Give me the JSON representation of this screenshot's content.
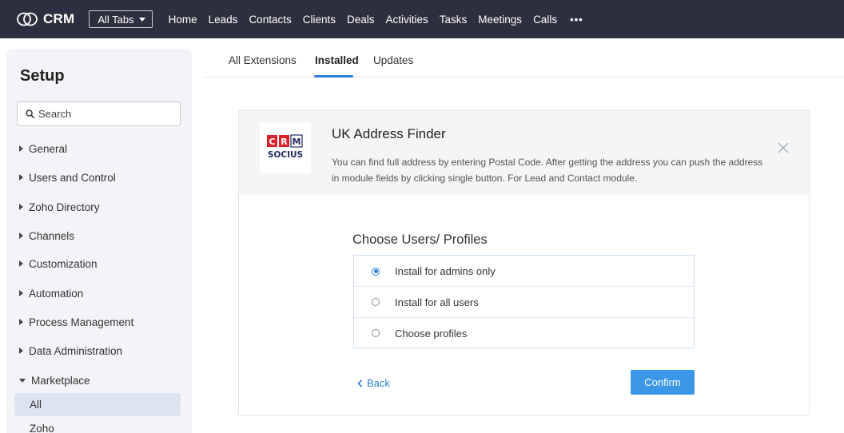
{
  "app": {
    "logo_text": "CRM",
    "all_tabs_label": "All Tabs"
  },
  "nav": {
    "items": [
      "Home",
      "Leads",
      "Contacts",
      "Clients",
      "Deals",
      "Activities",
      "Tasks",
      "Meetings",
      "Calls"
    ],
    "more_label": "•••"
  },
  "sidebar": {
    "title": "Setup",
    "search_placeholder": "Search",
    "items": [
      {
        "label": "General",
        "expanded": false
      },
      {
        "label": "Users and Control",
        "expanded": false
      },
      {
        "label": "Zoho Directory",
        "expanded": false
      },
      {
        "label": "Channels",
        "expanded": false
      },
      {
        "label": "Customization",
        "expanded": false
      },
      {
        "label": "Automation",
        "expanded": false
      },
      {
        "label": "Process Management",
        "expanded": false
      },
      {
        "label": "Data Administration",
        "expanded": false
      },
      {
        "label": "Marketplace",
        "expanded": true
      }
    ],
    "subitems": [
      {
        "label": "All",
        "active": true
      },
      {
        "label": "Zoho",
        "active": false
      }
    ]
  },
  "tabs": [
    {
      "label": "All Extensions",
      "active": false
    },
    {
      "label": "Installed",
      "active": true
    },
    {
      "label": "Updates",
      "active": false
    }
  ],
  "extension": {
    "logo_text_top": "CRM",
    "logo_text_bottom": "SOCIUS",
    "title": "UK Address Finder",
    "description": "You can find full address by entering Postal Code. After getting the address you can push the address in module fields by clicking single button. For Lead and Contact module."
  },
  "install": {
    "heading": "Choose Users/ Profiles",
    "options": [
      {
        "label": "Install for admins only",
        "selected": true
      },
      {
        "label": "Install for all users",
        "selected": false
      },
      {
        "label": "Choose profiles",
        "selected": false
      }
    ],
    "back_label": "Back",
    "confirm_label": "Confirm"
  },
  "colors": {
    "topbar": "#2e2f3e",
    "accent": "#2f7fd4",
    "confirm": "#3b98e8",
    "sidebar_bg": "#f3f4f7",
    "logo_red": "#d8232a",
    "logo_navy": "#1f2a5c"
  }
}
